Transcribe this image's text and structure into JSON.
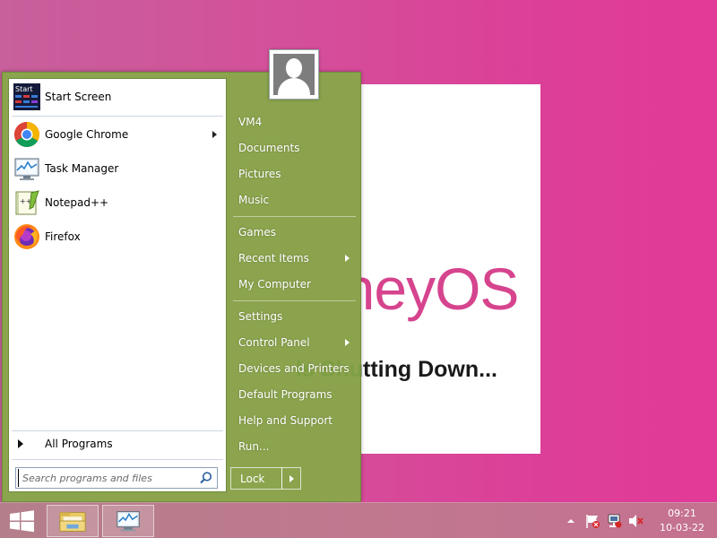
{
  "wallpaper": {
    "brand": "arneyOS",
    "status": "Is Shutting Down..."
  },
  "start_menu": {
    "programs": [
      {
        "label": "Start Screen",
        "icon": "start-screen-icon"
      },
      {
        "label": "Google Chrome",
        "icon": "chrome-icon",
        "has_submenu": true
      },
      {
        "label": "Task Manager",
        "icon": "task-manager-icon"
      },
      {
        "label": "Notepad++",
        "icon": "notepad-plus-plus-icon"
      },
      {
        "label": "Firefox",
        "icon": "firefox-icon"
      }
    ],
    "all_programs": "All Programs",
    "search_placeholder": "Search programs and files",
    "right_items": [
      {
        "label": "VM4"
      },
      {
        "label": "Documents"
      },
      {
        "label": "Pictures"
      },
      {
        "label": "Music"
      },
      {
        "label": "Games"
      },
      {
        "label": "Recent Items",
        "has_submenu": true
      },
      {
        "label": "My Computer"
      },
      {
        "label": "Settings"
      },
      {
        "label": "Control Panel",
        "has_submenu": true
      },
      {
        "label": "Devices and Printers"
      },
      {
        "label": "Default Programs"
      },
      {
        "label": "Help and Support"
      },
      {
        "label": "Run..."
      }
    ],
    "lock_label": "Lock"
  },
  "taskbar": {
    "clock_time": "09:21",
    "clock_date": "10-03-22",
    "pinned": [
      "file-explorer-icon",
      "task-manager-icon"
    ],
    "tray": [
      "show-hidden-icons-icon",
      "action-center-flag-icon",
      "network-icon",
      "volume-muted-icon"
    ]
  },
  "colors": {
    "menu_green": "#85aa47",
    "wallpaper_pink": "#dc3f98",
    "brand_pink": "#d6448e"
  }
}
